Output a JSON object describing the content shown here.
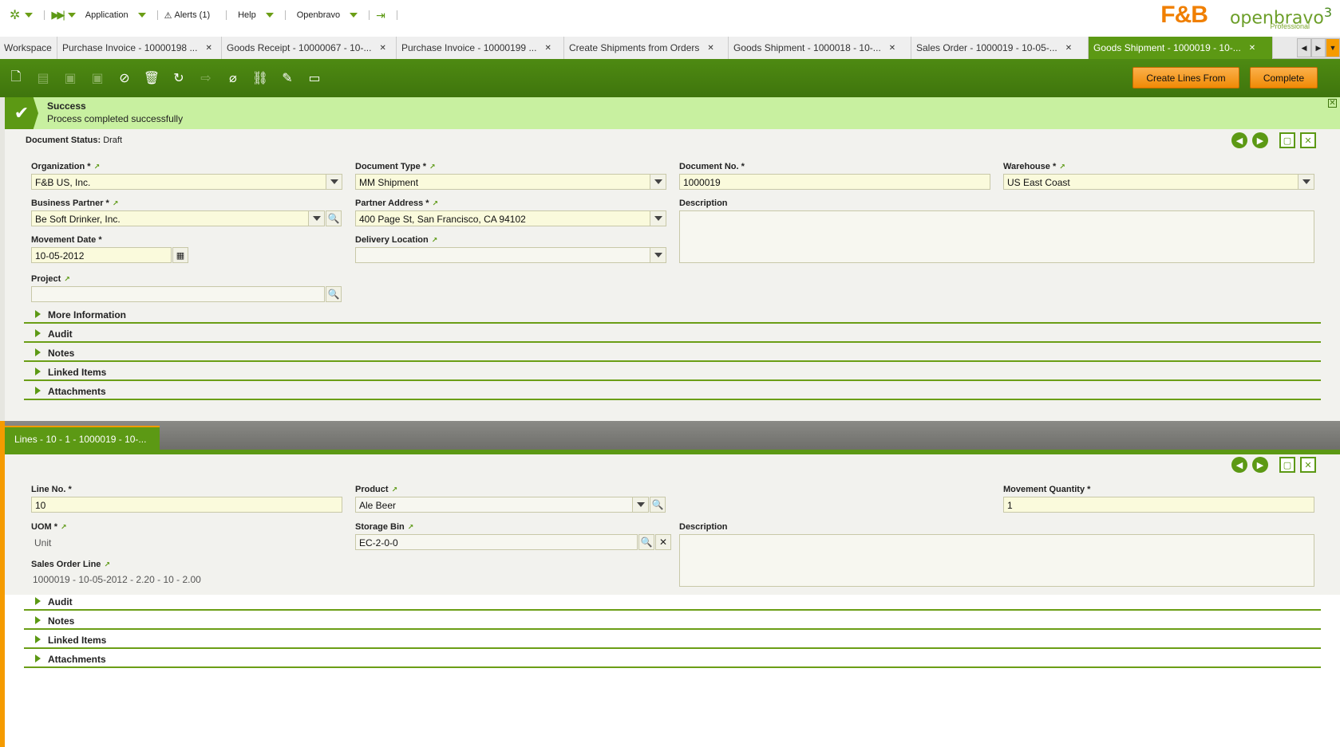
{
  "topmenu": {
    "items": [
      {
        "label": "Application"
      },
      {
        "label": "Alerts (1)"
      },
      {
        "label": "Help"
      },
      {
        "label": "Openbravo"
      }
    ]
  },
  "logo": {
    "fb": "F&B",
    "ob": "openbravo",
    "ob_version": "3",
    "ob_edition": "Professional"
  },
  "tabs": [
    {
      "label": "Workspace"
    },
    {
      "label": "Purchase Invoice - 10000198 ..."
    },
    {
      "label": "Goods Receipt - 10000067 - 10-..."
    },
    {
      "label": "Purchase Invoice - 10000199 ..."
    },
    {
      "label": "Create Shipments from Orders"
    },
    {
      "label": "Goods Shipment - 1000018 - 10-..."
    },
    {
      "label": "Sales Order - 1000019 - 10-05-..."
    },
    {
      "label": "Goods Shipment - 1000019 - 10-..."
    }
  ],
  "toolbar": {
    "create_lines_label": "Create Lines From",
    "complete_label": "Complete"
  },
  "message": {
    "title": "Success",
    "text": "Process completed successfully"
  },
  "header": {
    "status_label": "Document Status:",
    "status_value": "Draft",
    "organization_label": "Organization *",
    "organization_value": "F&B US, Inc.",
    "doctype_label": "Document Type *",
    "doctype_value": "MM Shipment",
    "docno_label": "Document No. *",
    "docno_value": "1000019",
    "warehouse_label": "Warehouse *",
    "warehouse_value": "US East Coast",
    "bp_label": "Business Partner *",
    "bp_value": "Be Soft Drinker, Inc.",
    "address_label": "Partner Address *",
    "address_value": "400 Page St, San Francisco, CA 94102",
    "desc_label": "Description",
    "movdate_label": "Movement Date *",
    "movdate_value": "10-05-2012",
    "delivery_label": "Delivery Location",
    "project_label": "Project",
    "sections": [
      "More Information",
      "Audit",
      "Notes",
      "Linked Items",
      "Attachments"
    ]
  },
  "lines": {
    "tab_label": "Lines - 10 - 1 - 1000019 - 10-...",
    "lineno_label": "Line No. *",
    "lineno_value": "10",
    "product_label": "Product",
    "product_value": "Ale Beer",
    "qty_label": "Movement Quantity *",
    "qty_value": "1",
    "uom_label": "UOM *",
    "uom_value": "Unit",
    "bin_label": "Storage Bin",
    "bin_value": "EC-2-0-0",
    "desc_label": "Description",
    "sol_label": "Sales Order Line",
    "sol_value": "1000019 - 10-05-2012 - 2.20 - 10 - 2.00",
    "sections": [
      "Audit",
      "Notes",
      "Linked Items",
      "Attachments"
    ]
  }
}
